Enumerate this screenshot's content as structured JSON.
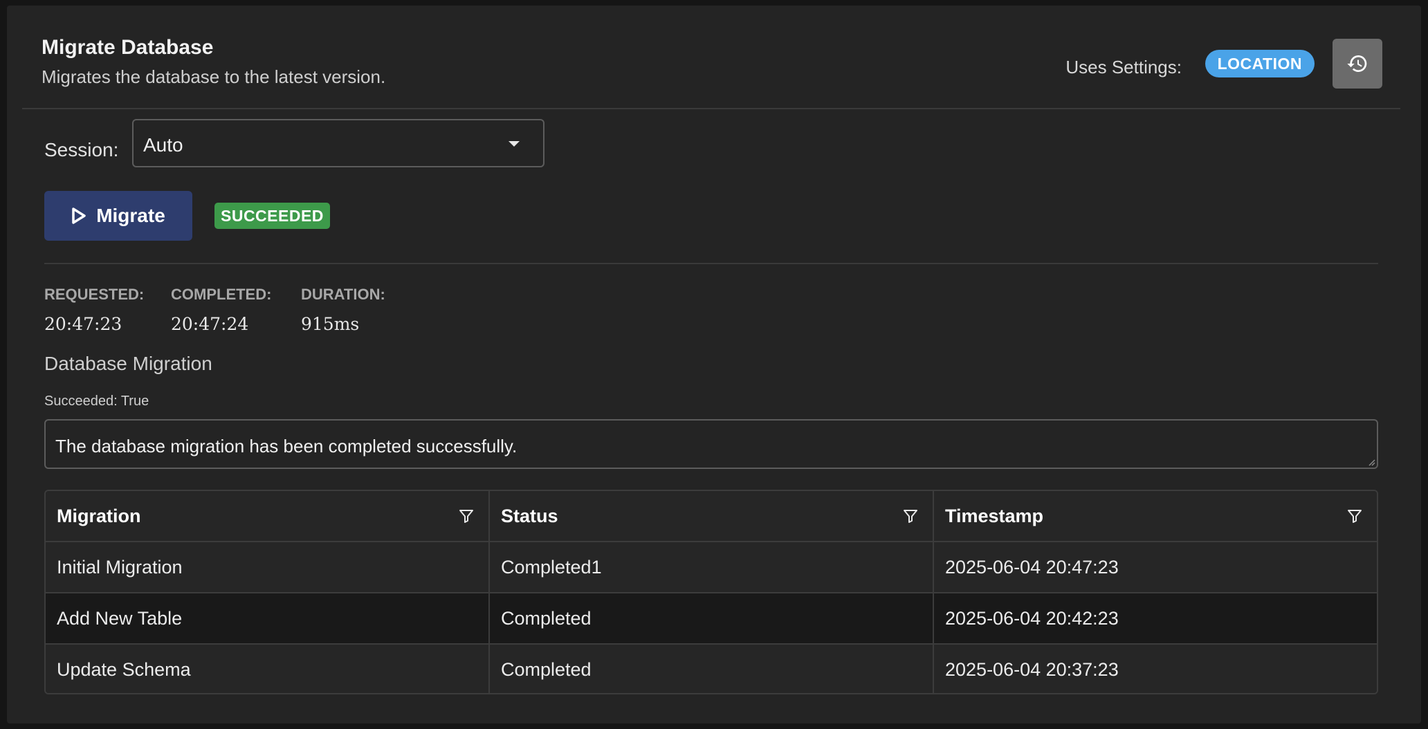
{
  "header": {
    "title": "Migrate Database",
    "subtitle": "Migrates the database to the latest version.",
    "uses_settings_label": "Uses Settings:",
    "settings_badge": "LOCATION"
  },
  "session": {
    "label": "Session:",
    "value": "Auto"
  },
  "actions": {
    "migrate_label": "Migrate",
    "status_badge": "SUCCEEDED"
  },
  "stats": {
    "requested_label": "REQUESTED:",
    "requested_value": "20:47:23",
    "completed_label": "COMPLETED:",
    "completed_value": "20:47:24",
    "duration_label": "DURATION:",
    "duration_value": "915ms"
  },
  "result": {
    "section_title": "Database Migration",
    "succeeded_line": "Succeeded: True",
    "message": "The database migration has been completed successfully."
  },
  "table": {
    "columns": [
      "Migration",
      "Status",
      "Timestamp"
    ],
    "rows": [
      [
        "Initial Migration",
        "Completed1",
        "2025-06-04 20:47:23"
      ],
      [
        "Add New Table",
        "Completed",
        "2025-06-04 20:42:23"
      ],
      [
        "Update Schema",
        "Completed",
        "2025-06-04 20:37:23"
      ]
    ]
  },
  "colors": {
    "accent_blue": "#4aa3e8",
    "migrate_button": "#2e3d6e",
    "success_green": "#3d9a4a"
  },
  "icons": {
    "history": "history-icon",
    "play": "play-icon",
    "dropdown": "chevron-down-icon",
    "filter": "filter-icon"
  }
}
